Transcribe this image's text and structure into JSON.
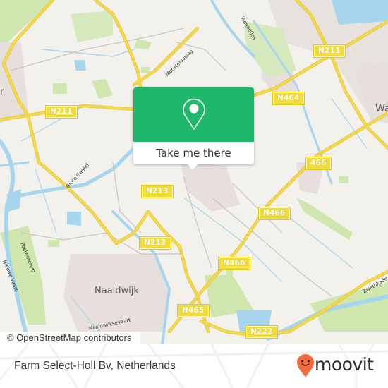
{
  "map": {
    "place_labels": [
      {
        "id": "naaldwijk",
        "text": "Naaldwijk"
      },
      {
        "id": "wateringen-partial",
        "text": "Wa"
      },
      {
        "id": "left-partial",
        "text": "r"
      }
    ],
    "road_shields": [
      {
        "id": "n211-west",
        "text": "N211"
      },
      {
        "id": "n211-east",
        "text": "N211"
      },
      {
        "id": "n464",
        "text": "N464"
      },
      {
        "id": "466",
        "text": "466"
      },
      {
        "id": "n213-north",
        "text": "N213"
      },
      {
        "id": "n213-south",
        "text": "N213"
      },
      {
        "id": "n466-north",
        "text": "N466"
      },
      {
        "id": "n466-south",
        "text": "N466"
      },
      {
        "id": "n465",
        "text": "N465"
      },
      {
        "id": "n222",
        "text": "N222"
      }
    ],
    "water_labels": [
      {
        "id": "grote-gantel",
        "text": "Grote Gantel"
      },
      {
        "id": "wennetjes",
        "text": "Wennetjes"
      },
      {
        "id": "nieuwe-vaart",
        "text": "Nieuwe Vaart"
      },
      {
        "id": "poelwatering",
        "text": "Poelwatering"
      },
      {
        "id": "naaldwijksevaart",
        "text": "Naaldwijksevaart"
      },
      {
        "id": "zwethkade",
        "text": "Zwethkade"
      },
      {
        "id": "monsterseweg",
        "text": "Monsterseweg"
      }
    ],
    "colors": {
      "land": "#f2f1ec",
      "water": "#a8d5ee",
      "road": "#f4d94c",
      "green": "#cfe6ae",
      "urban": "#e6dfdb"
    }
  },
  "popup": {
    "icon": "map-pin-icon",
    "button_label": "Take me there",
    "accent": "#1fb86a"
  },
  "attribution": "© OpenStreetMap contributors",
  "footer": {
    "place_name": "Farm Select-Holl Bv, Netherlands",
    "brand": "moovit",
    "brand_icon": "moovit-smiley-pin-icon",
    "brand_color": "#f26a3d"
  }
}
